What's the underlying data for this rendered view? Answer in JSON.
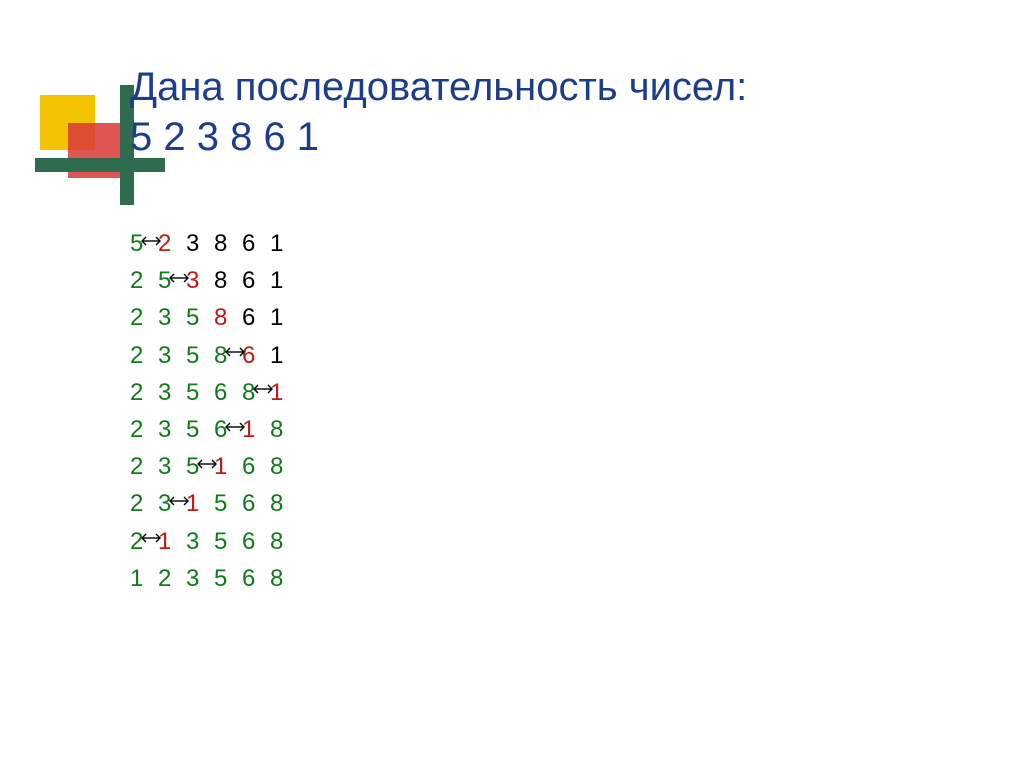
{
  "title": {
    "line1": "Дана последовательность чисел:",
    "line2": "5  2  3  8  6  1"
  },
  "arrow_color": "#000000",
  "rows": [
    [
      {
        "t": "5",
        "c": "g"
      },
      {
        "arrow": true
      },
      {
        "t": "2",
        "c": "r"
      },
      {
        "t": "3",
        "c": "b"
      },
      {
        "t": "8",
        "c": "b"
      },
      {
        "t": "6",
        "c": "b"
      },
      {
        "t": "1",
        "c": "b"
      }
    ],
    [
      {
        "t": "2",
        "c": "g"
      },
      {
        "t": "5",
        "c": "g"
      },
      {
        "arrow": true
      },
      {
        "t": "3",
        "c": "r"
      },
      {
        "t": "8",
        "c": "b"
      },
      {
        "t": "6",
        "c": "b"
      },
      {
        "t": "1",
        "c": "b"
      }
    ],
    [
      {
        "t": "2",
        "c": "g"
      },
      {
        "t": "3",
        "c": "g"
      },
      {
        "t": "5",
        "c": "g"
      },
      {
        "t": "8",
        "c": "r"
      },
      {
        "t": "6",
        "c": "b"
      },
      {
        "t": "1",
        "c": "b"
      }
    ],
    [
      {
        "t": "2",
        "c": "g"
      },
      {
        "t": "3",
        "c": "g"
      },
      {
        "t": "5",
        "c": "g"
      },
      {
        "t": "8",
        "c": "g"
      },
      {
        "arrow": true
      },
      {
        "t": "6",
        "c": "r"
      },
      {
        "t": "1",
        "c": "b"
      }
    ],
    [
      {
        "t": "2",
        "c": "g"
      },
      {
        "t": "3",
        "c": "g"
      },
      {
        "t": "5",
        "c": "g"
      },
      {
        "t": "6",
        "c": "g"
      },
      {
        "t": "8",
        "c": "g"
      },
      {
        "arrow": true
      },
      {
        "t": "1",
        "c": "r"
      }
    ],
    [
      {
        "t": "2",
        "c": "g"
      },
      {
        "t": "3",
        "c": "g"
      },
      {
        "t": "5",
        "c": "g"
      },
      {
        "t": "6",
        "c": "g"
      },
      {
        "arrow": true
      },
      {
        "t": "1",
        "c": "r"
      },
      {
        "t": "8",
        "c": "g"
      }
    ],
    [
      {
        "t": "2",
        "c": "g"
      },
      {
        "t": "3",
        "c": "g"
      },
      {
        "t": "5",
        "c": "g"
      },
      {
        "arrow": true
      },
      {
        "t": "1",
        "c": "r"
      },
      {
        "t": "6",
        "c": "g"
      },
      {
        "t": "8",
        "c": "g"
      }
    ],
    [
      {
        "t": "2",
        "c": "g"
      },
      {
        "t": "3",
        "c": "g"
      },
      {
        "arrow": true
      },
      {
        "t": "1",
        "c": "r"
      },
      {
        "t": "5",
        "c": "g"
      },
      {
        "t": "6",
        "c": "g"
      },
      {
        "t": "8",
        "c": "g"
      }
    ],
    [
      {
        "t": "2",
        "c": "g"
      },
      {
        "arrow": true
      },
      {
        "t": "1",
        "c": "r"
      },
      {
        "t": "3",
        "c": "g"
      },
      {
        "t": "5",
        "c": "g"
      },
      {
        "t": "6",
        "c": "g"
      },
      {
        "t": "8",
        "c": "g"
      }
    ],
    [
      {
        "t": "1",
        "c": "g"
      },
      {
        "t": "2",
        "c": "g"
      },
      {
        "t": "3",
        "c": "g"
      },
      {
        "t": "5",
        "c": "g"
      },
      {
        "t": "6",
        "c": "g"
      },
      {
        "t": "8",
        "c": "g"
      }
    ]
  ]
}
